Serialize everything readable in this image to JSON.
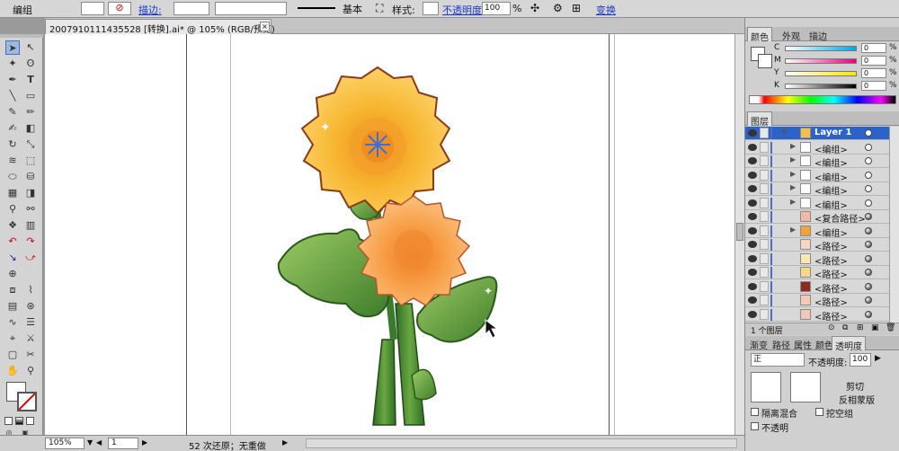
{
  "control_bar": {
    "object_type": "编组",
    "stroke_label": "描边:",
    "stroke_profile": "基本",
    "style_label": "样式:",
    "opacity_label": "不透明度:",
    "opacity_value": "100",
    "percent": "%",
    "transform_label": "变换"
  },
  "document_tab": {
    "title": "20079101114355​28 [转换].ai* @ 105% (RGB/预览)",
    "close_glyph": "×"
  },
  "status_bar": {
    "zoom": "105%",
    "artboard": "1",
    "history": "52 次还原；无重做"
  },
  "color_panel": {
    "tabs": [
      "颜色",
      "外观",
      "描边"
    ],
    "channels": [
      {
        "label": "C",
        "value": "0",
        "gradient": "#00a8e8"
      },
      {
        "label": "M",
        "value": "0",
        "gradient": "#e8007c"
      },
      {
        "label": "Y",
        "value": "0",
        "gradient": "#ffe600"
      },
      {
        "label": "K",
        "value": "0",
        "gradient": "#000000"
      }
    ],
    "percent": "%"
  },
  "layers_panel": {
    "tab": "图层",
    "rows": [
      {
        "name": "Layer 1",
        "thumb": "#f5c04a",
        "head": true
      },
      {
        "name": "<编组>",
        "thumb": "#ffffff"
      },
      {
        "name": "<编组>",
        "thumb": "#ffffff"
      },
      {
        "name": "<编组>",
        "thumb": "#ffffff"
      },
      {
        "name": "<编组>",
        "thumb": "#ffffff"
      },
      {
        "name": "<编组>",
        "thumb": "#ffffff"
      },
      {
        "name": "<复合路径>",
        "thumb": "#f4b9a2"
      },
      {
        "name": "<编组>",
        "thumb": "#f1a33b"
      },
      {
        "name": "<路径>",
        "thumb": "#f6d5c3"
      },
      {
        "name": "<路径>",
        "thumb": "#f9e8b0"
      },
      {
        "name": "<路径>",
        "thumb": "#f8d78a"
      },
      {
        "name": "<路径>",
        "thumb": "#8a2d1e"
      },
      {
        "name": "<路径>",
        "thumb": "#f7c9b4"
      },
      {
        "name": "<路径>",
        "thumb": "#f3c8b5"
      }
    ],
    "footer_count": "1 个图层"
  },
  "transparency_panel": {
    "tabs": [
      "渐变",
      "路径",
      "属性",
      "颜色",
      "透明度"
    ],
    "blend_mode": "正",
    "opacity_label": "不透明度:",
    "opacity_value": "100",
    "clip_label": "剪切",
    "invert_mask": "反相蒙版",
    "isolate_blend": "隔离混合",
    "knockout_group": "挖空组",
    "opacity_mask": "不透明"
  },
  "colors": {
    "accent": "#2b63c8",
    "petal_yellow": "#f6b62d",
    "petal_orange": "#f7a64b",
    "leaf_green": "#5c9c3a"
  }
}
